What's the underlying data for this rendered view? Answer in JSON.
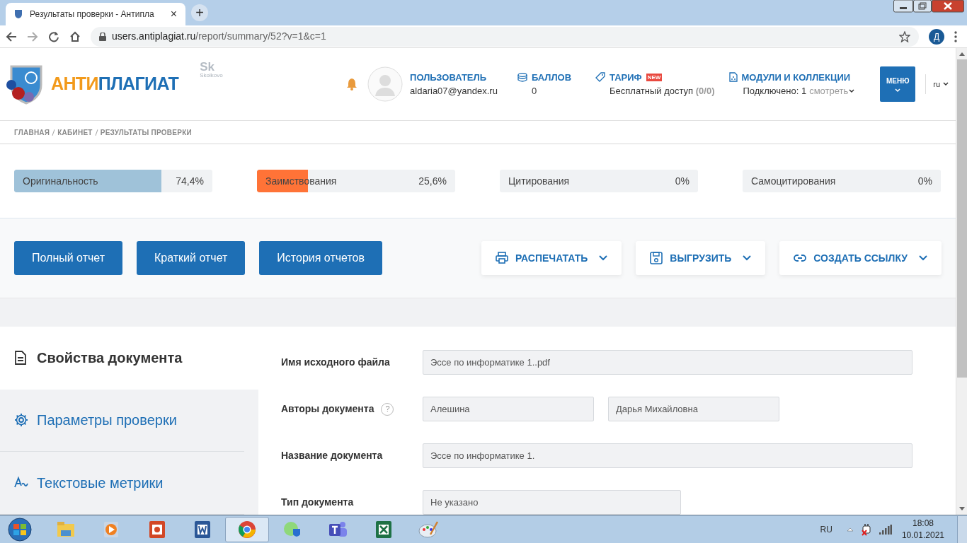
{
  "browser": {
    "tab_title": "Результаты проверки - Антипла",
    "close": "×",
    "new_tab": "+",
    "url_host": "users.antiplagiat.ru",
    "url_path": "/report/summary/52?v=1&c=1",
    "profile": "Д"
  },
  "header": {
    "logo_part1": "АНТИ",
    "logo_part2": "ПЛАГИАТ",
    "sk_mark": "Sk",
    "sk_caption": "Skolkovo",
    "user": {
      "label": "ПОЛЬЗОВАТЕЛЬ",
      "email": "aldaria07@yandex.ru"
    },
    "points": {
      "label": "БАЛЛОВ",
      "value": "0"
    },
    "tariff": {
      "label": "ТАРИФ",
      "badge": "NEW",
      "text": "Бесплатный доступ",
      "count": "(0/0)"
    },
    "modules": {
      "label": "МОДУЛИ И КОЛЛЕКЦИИ",
      "text": "Подключено: 1",
      "link": "смотреть"
    },
    "menu": "МЕНЮ",
    "language": "ru"
  },
  "breadcrumbs": [
    "ГЛАВНАЯ",
    "КАБИНЕТ",
    "РЕЗУЛЬТАТЫ ПРОВЕРКИ"
  ],
  "stats": [
    {
      "label": "Оригинальность",
      "value": "74,4%",
      "level": 0.744,
      "color": "#9fc2d9"
    },
    {
      "label": "Заимствования",
      "value": "25,6%",
      "level": 0.256,
      "color": "#ff7337"
    },
    {
      "label": "Цитирования",
      "value": "0%",
      "level": 0
    },
    {
      "label": "Самоцитирования",
      "value": "0%",
      "level": 0
    }
  ],
  "report_buttons": [
    "Полный отчет",
    "Краткий отчет",
    "История отчетов"
  ],
  "action_buttons": [
    {
      "kind": "print",
      "label": "РАСПЕЧАТАТЬ"
    },
    {
      "kind": "save",
      "label": "ВЫГРУЗИТЬ"
    },
    {
      "kind": "link",
      "label": "СОЗДАТЬ ССЫЛКУ"
    }
  ],
  "sidebar": {
    "items": [
      {
        "kind": "document",
        "label": "Свойства документа",
        "selected": true
      },
      {
        "kind": "gear",
        "label": "Параметры проверки",
        "selected": false
      },
      {
        "kind": "metrics",
        "label": "Текстовые метрики",
        "selected": false
      }
    ]
  },
  "form": {
    "rows": [
      {
        "label": "Имя исходного файла",
        "values": [
          "Эссе по информатике 1..pdf"
        ]
      },
      {
        "label": "Авторы документа",
        "help": "?",
        "values": [
          "Алешина",
          "Дарья Михайловна"
        ]
      },
      {
        "label": "Название документа",
        "values": [
          "Эссе по информатике 1."
        ]
      },
      {
        "label": "Тип документа",
        "values": [
          "Не указано"
        ],
        "short": true
      }
    ]
  },
  "taskbar": {
    "language": "RU",
    "time": "18:08",
    "date": "10.01.2021"
  }
}
